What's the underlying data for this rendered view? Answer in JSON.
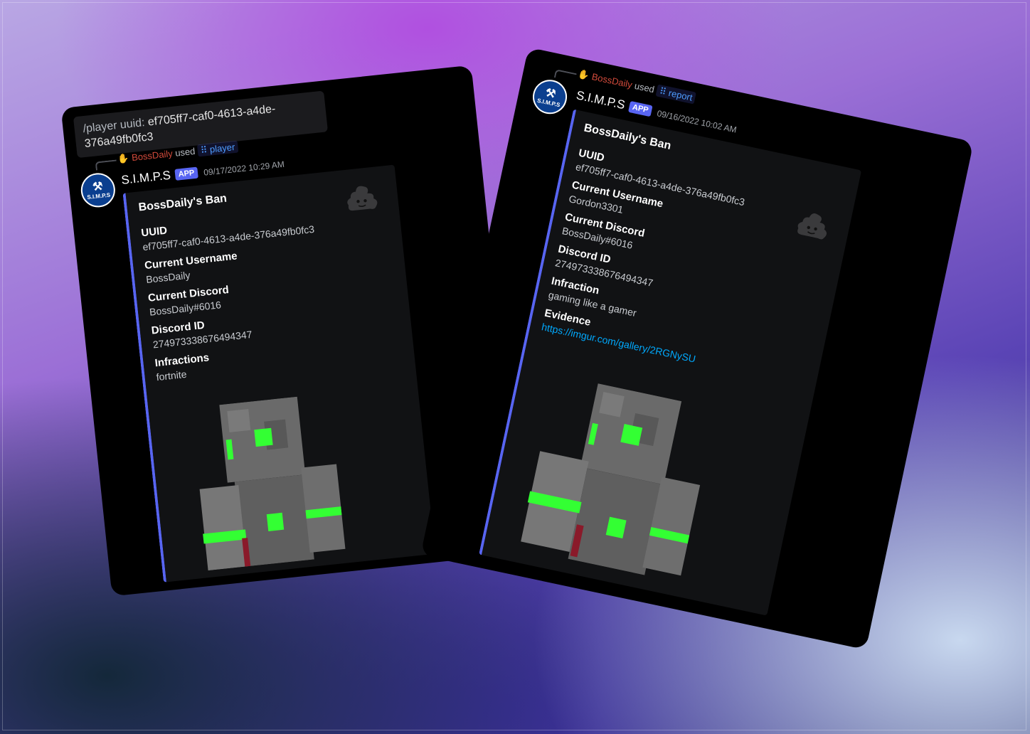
{
  "left_panel": {
    "command": {
      "prefix": "/player uuid:",
      "value": "ef705ff7-caf0-4613-a4de-376a49fb0fc3"
    },
    "reply": {
      "user": "BossDaily",
      "used": "used",
      "command": "player"
    },
    "bot": {
      "name": "S.I.M.P.S",
      "badge": "APP",
      "timestamp": "09/17/2022 10:29 AM"
    },
    "avatar_text": "S.I.M.P.S",
    "embed": {
      "title": "BossDaily's Ban",
      "fields": [
        {
          "name": "UUID",
          "value": "ef705ff7-caf0-4613-a4de-376a49fb0fc3"
        },
        {
          "name": "Current Username",
          "value": "BossDaily"
        },
        {
          "name": "Current Discord",
          "value": "BossDaily#6016"
        },
        {
          "name": "Discord ID",
          "value": "274973338676494347"
        },
        {
          "name": "Infractions",
          "value": "fortnite"
        }
      ]
    }
  },
  "right_panel": {
    "reply": {
      "user": "BossDaily",
      "used": "used",
      "command": "report"
    },
    "bot": {
      "name": "S.I.M.P.S",
      "badge": "APP",
      "timestamp": "09/16/2022 10:02 AM"
    },
    "avatar_text": "S.I.M.P.S",
    "embed": {
      "title": "BossDaily's Ban",
      "fields": [
        {
          "name": "UUID",
          "value": "ef705ff7-caf0-4613-a4de-376a49fb0fc3"
        },
        {
          "name": "Current Username",
          "value": "Gordon3301"
        },
        {
          "name": "Current Discord",
          "value": "BossDaily#6016"
        },
        {
          "name": "Discord ID",
          "value": "274973338676494347"
        },
        {
          "name": "Infraction",
          "value": "gaming like a gamer"
        },
        {
          "name": "Evidence",
          "value": "https://imgur.com/gallery/2RGNySU"
        }
      ]
    }
  },
  "colors": {
    "accent": "#5865f2",
    "link": "#00a8fc",
    "username": "#d14a3b",
    "skin_green": "#33ff33"
  },
  "icons": [
    "reply-hand-icon",
    "slash-command-icon",
    "gavel-icon",
    "poop-emoji-icon",
    "minecraft-skin-render"
  ]
}
